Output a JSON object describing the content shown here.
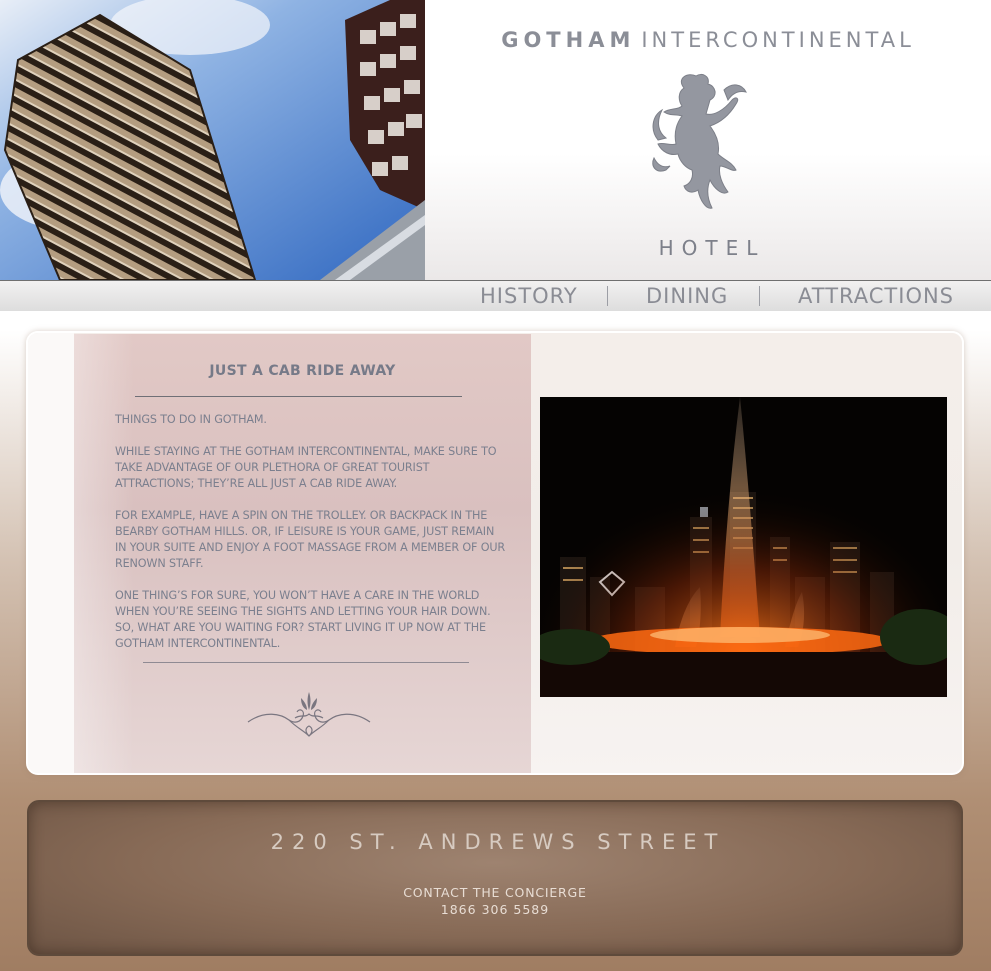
{
  "brand": {
    "name_bold": "GOTHAM",
    "name_light": "INTERCONTINENTAL",
    "subtitle": "HOTEL"
  },
  "nav": {
    "items": [
      {
        "label": "HISTORY"
      },
      {
        "label": "DINING"
      },
      {
        "label": "ATTRACTIONS"
      }
    ]
  },
  "content": {
    "title": "JUST A CAB RIDE AWAY",
    "paragraphs": [
      "THINGS TO DO IN GOTHAM.",
      "WHILE STAYING AT THE GOTHAM INTERCONTINENTAL, MAKE SURE TO TAKE ADVANTAGE OF OUR PLETHORA OF GREAT TOURIST ATTRACTIONS; THEY’RE ALL JUST A CAB RIDE AWAY.",
      "FOR EXAMPLE, HAVE A SPIN ON THE TROLLEY. OR BACKPACK IN THE BEARBY GOTHAM HILLS. OR, IF LEISURE IS YOUR GAME, JUST REMAIN IN YOUR SUITE AND ENJOY A FOOT MASSAGE FROM A MEMBER OF OUR RENOWN STAFF.",
      "ONE THING’S FOR SURE, YOU WON’T HAVE A CARE IN THE WORLD WHEN YOU’RE SEEING THE SIGHTS AND LETTING YOUR HAIR DOWN. SO, WHAT ARE YOU WAITING FOR? START LIVING IT UP NOW AT THE GOTHAM INTERCONTINENTAL."
    ]
  },
  "footer": {
    "address": "220 ST. ANDREWS STREET",
    "contact_label": "CONTACT THE CONCIERGE",
    "phone": "1866 306 5589"
  },
  "colors": {
    "brand_grey": "#8b8e97",
    "panel_pink": "#dcc4c2",
    "footer_brown": "#876a56"
  },
  "icons": {
    "logo": "rampant-lion-icon",
    "ornament": "flourish-ornament-icon"
  }
}
